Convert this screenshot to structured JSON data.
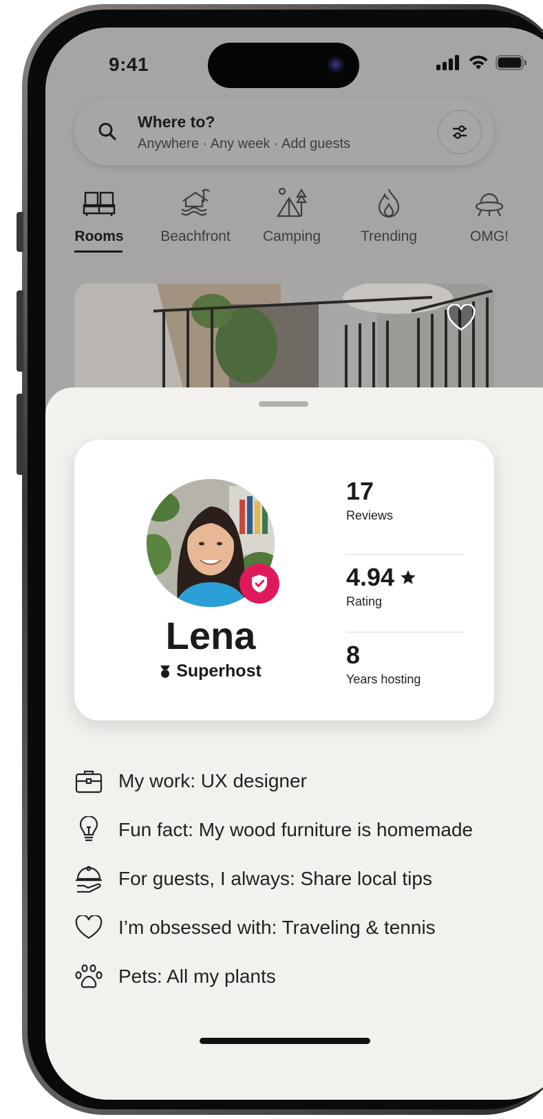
{
  "status_bar": {
    "time": "9:41"
  },
  "search": {
    "title": "Where to?",
    "subtitle": "Anywhere · Any week · Add guests"
  },
  "categories": [
    {
      "label": "Rooms",
      "icon": "bed-icon",
      "active": true
    },
    {
      "label": "Beachfront",
      "icon": "beach-house-icon"
    },
    {
      "label": "Camping",
      "icon": "tent-icon"
    },
    {
      "label": "Trending",
      "icon": "flame-icon"
    },
    {
      "label": "OMG!",
      "icon": "ufo-icon"
    }
  ],
  "host_card": {
    "name": "Lena",
    "badge": "Superhost",
    "stats": [
      {
        "value": "17",
        "label": "Reviews"
      },
      {
        "value": "4.94",
        "label": "Rating",
        "icon": "star-icon"
      },
      {
        "value": "8",
        "label": "Years hosting"
      }
    ]
  },
  "facts": [
    {
      "icon": "briefcase-icon",
      "text": "My work: UX designer"
    },
    {
      "icon": "lightbulb-icon",
      "text": "Fun fact: My wood furniture is homemade"
    },
    {
      "icon": "serving-dish-icon",
      "text": "For guests, I always: Share local tips"
    },
    {
      "icon": "heart-icon",
      "text": "I’m obsessed with: Traveling & tennis"
    },
    {
      "icon": "paw-icon",
      "text": "Pets: All my plants"
    }
  ],
  "colors": {
    "accent": "#E0195B",
    "sheet_bg": "#F3F1EE",
    "text": "#222222"
  }
}
